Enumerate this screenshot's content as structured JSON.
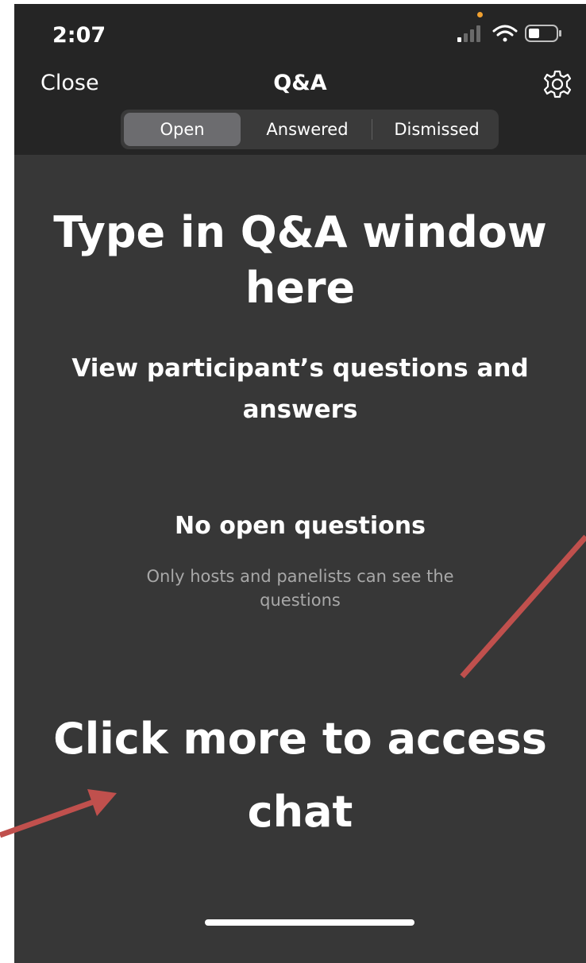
{
  "status_bar": {
    "time": "2:07"
  },
  "nav": {
    "close_label": "Close",
    "title": "Q&A",
    "settings_icon": "gear-icon"
  },
  "tabs": [
    {
      "label": "Open",
      "selected": true
    },
    {
      "label": "Answered",
      "selected": false
    },
    {
      "label": "Dismissed",
      "selected": false
    }
  ],
  "annotations": {
    "headline": "Type in Q&A window here",
    "subheadline": "View participant’s questions and answers",
    "chat_hint": "Click more to access chat",
    "arrow_color": "#c0504d"
  },
  "empty_state": {
    "title": "No open questions",
    "subtitle": "Only hosts and panelists can see the questions"
  },
  "colors": {
    "background": "#373737",
    "header": "#252525",
    "selected_tab": "#6c6c6f"
  }
}
